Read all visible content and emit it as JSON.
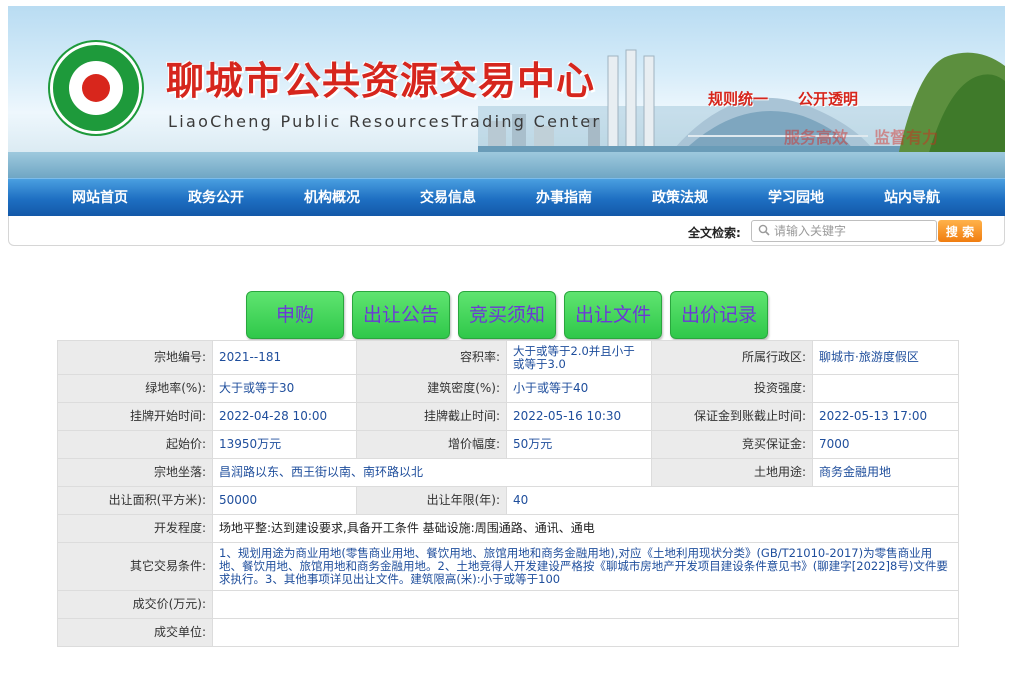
{
  "header": {
    "title_cn": "聊城市公共资源交易中心",
    "title_en": "LiaoCheng Public ResourcesTrading Center",
    "slogan_1": "规则统一",
    "slogan_2": "公开透明",
    "slogan_3": "服务高效",
    "slogan_4": "监督有力"
  },
  "nav": {
    "items": [
      "网站首页",
      "政务公开",
      "机构概况",
      "交易信息",
      "办事指南",
      "政策法规",
      "学习园地",
      "站内导航"
    ]
  },
  "search": {
    "label": "全文检索:",
    "placeholder": "请输入关键字",
    "button": "搜 索"
  },
  "tabs": [
    "申购",
    "出让公告",
    "竞买须知",
    "出让文件",
    "出价记录"
  ],
  "detail": {
    "parcel_no_label": "宗地编号:",
    "parcel_no": "2021--181",
    "far_label": "容积率:",
    "far": "大于或等于2.0并且小于或等于3.0",
    "district_label": "所属行政区:",
    "district": "聊城市·旅游度假区",
    "green_label": "绿地率(%):",
    "green": "大于或等于30",
    "density_label": "建筑密度(%):",
    "density": "小于或等于40",
    "invest_label": "投资强度:",
    "invest": "",
    "listing_start_label": "挂牌开始时间:",
    "listing_start": "2022-04-28 10:00",
    "listing_end_label": "挂牌截止时间:",
    "listing_end": "2022-05-16 10:30",
    "deposit_deadline_label": "保证金到账截止时间:",
    "deposit_deadline": "2022-05-13 17:00",
    "start_price_label": "起始价:",
    "start_price": "13950万元",
    "increment_label": "增价幅度:",
    "increment": "50万元",
    "bid_deposit_label": "竞买保证金:",
    "bid_deposit": "7000",
    "location_label": "宗地坐落:",
    "location": "昌润路以东、西王街以南、南环路以北",
    "land_use_label": "土地用途:",
    "land_use": "商务金融用地",
    "area_label": "出让面积(平方米):",
    "area": "50000",
    "term_label": "出让年限(年):",
    "term": "40",
    "dev_label": "开发程度:",
    "dev": "场地平整:达到建设要求,具备开工条件 基础设施:周围通路、通讯、通电",
    "other_label": "其它交易条件:",
    "other": "1、规划用途为商业用地(零售商业用地、餐饮用地、旅馆用地和商务金融用地),对应《土地利用现状分类》(GB/T21010-2017)为零售商业用地、餐饮用地、旅馆用地和商务金融用地。2、土地竞得人开发建设严格按《聊城市房地产开发项目建设条件意见书》(聊建字[2022]8号)文件要求执行。3、其他事项详见出让文件。建筑限高(米):小于或等于100",
    "deal_price_label": "成交价(万元):",
    "deal_price": "",
    "deal_unit_label": "成交单位:",
    "deal_unit": ""
  }
}
